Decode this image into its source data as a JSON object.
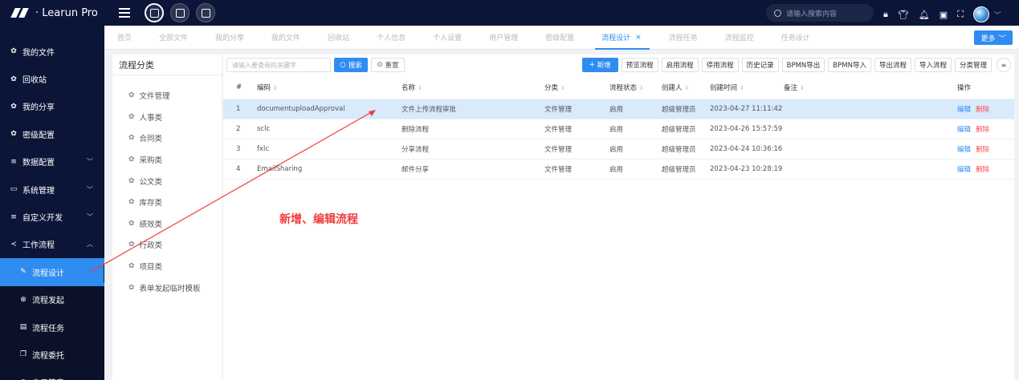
{
  "app": {
    "title": "· Learun Pro"
  },
  "topbar": {
    "search_placeholder": "请输入搜索内容",
    "icons": [
      "lock-icon",
      "shirt-icon",
      "bell-icon",
      "message-icon",
      "fullscreen-icon"
    ]
  },
  "leftnav": {
    "items": [
      {
        "label": "我的文件",
        "icon": "gear",
        "chev": ""
      },
      {
        "label": "回收站",
        "icon": "gear",
        "chev": ""
      },
      {
        "label": "我的分享",
        "icon": "gear",
        "chev": ""
      },
      {
        "label": "密级配置",
        "icon": "gear",
        "chev": ""
      },
      {
        "label": "数据配置",
        "icon": "list",
        "chev": "﹀"
      },
      {
        "label": "系统管理",
        "icon": "monitor",
        "chev": "﹀"
      },
      {
        "label": "自定义开发",
        "icon": "list",
        "chev": "﹀"
      },
      {
        "label": "工作流程",
        "icon": "share",
        "chev": "︿"
      }
    ],
    "subitems": [
      {
        "label": "流程设计",
        "icon": "edit",
        "selected": true
      },
      {
        "label": "流程发起",
        "icon": "plus-circle",
        "selected": false
      },
      {
        "label": "流程任务",
        "icon": "tasks",
        "selected": false
      },
      {
        "label": "流程委托",
        "icon": "copy",
        "selected": false
      },
      {
        "label": "电子签章",
        "icon": "seal",
        "selected": false
      }
    ]
  },
  "tabs": {
    "items": [
      "首页",
      "全部文件",
      "我的分享",
      "我的文件",
      "回收站",
      "个人信息",
      "个人设置",
      "用户管理",
      "密级配置",
      "流程设计",
      "流程任务",
      "流程监控",
      "任务设计"
    ],
    "active_index": 9,
    "more_label": "更多"
  },
  "category": {
    "title": "流程分类",
    "items": [
      "文件管理",
      "人事类",
      "合同类",
      "采购类",
      "公文类",
      "库存类",
      "绩效类",
      "行政类",
      "项目类",
      "表单发起临时模板"
    ]
  },
  "toolbar": {
    "keyword_placeholder": "请输入要查询的关键字",
    "search_label": "搜索",
    "reset_label": "重置",
    "buttons": [
      "新增",
      "预览流程",
      "启用流程",
      "停用流程",
      "历史记录",
      "BPMN导出",
      "BPMN导入",
      "导出流程",
      "导入流程",
      "分类管理"
    ]
  },
  "table": {
    "headers": [
      "#",
      "编码",
      "名称",
      "分类",
      "流程状态",
      "创建人",
      "创建时间",
      "备注",
      "操作"
    ],
    "rows": [
      {
        "num": "1",
        "code": "documentuploadApproval",
        "name": "文件上传流程审批",
        "category": "文件管理",
        "status": "启用",
        "creator": "超级管理员",
        "created": "2023-04-27 11:11:42",
        "remark": "",
        "edit": "编辑",
        "del": "删除"
      },
      {
        "num": "2",
        "code": "sclc",
        "name": "删除流程",
        "category": "文件管理",
        "status": "启用",
        "creator": "超级管理员",
        "created": "2023-04-26 15:57:59",
        "remark": "",
        "edit": "编辑",
        "del": "删除"
      },
      {
        "num": "3",
        "code": "fxlc",
        "name": "分享流程",
        "category": "文件管理",
        "status": "启用",
        "creator": "超级管理员",
        "created": "2023-04-24 10:36:16",
        "remark": "",
        "edit": "编辑",
        "del": "删除"
      },
      {
        "num": "4",
        "code": "EmailSharing",
        "name": "邮件分享",
        "category": "文件管理",
        "status": "启用",
        "creator": "超级管理员",
        "created": "2023-04-23 10:28:19",
        "remark": "",
        "edit": "编辑",
        "del": "删除"
      }
    ],
    "highlight_row": 0
  },
  "annotation": {
    "text": "新增、编辑流程",
    "color": "#f03c3c"
  },
  "colors": {
    "accent": "#2f8cf0",
    "nav_bg": "#0b1538",
    "danger": "#ff4d4f"
  }
}
